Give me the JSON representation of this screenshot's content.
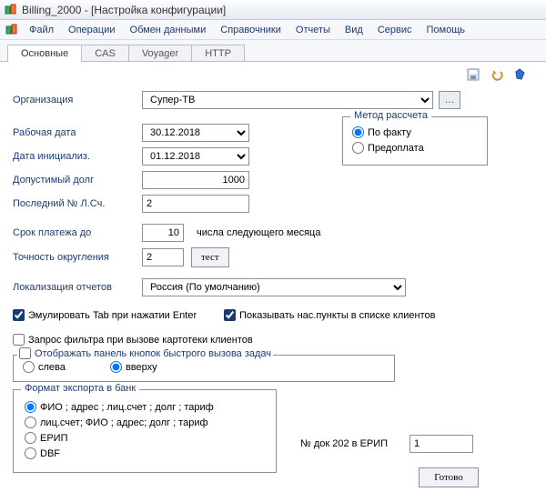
{
  "window": {
    "title": "Billing_2000 - [Настройка конфигурации]"
  },
  "menu": {
    "items": [
      "Файл",
      "Операции",
      "Обмен данными",
      "Справочники",
      "Отчеты",
      "Вид",
      "Сервис",
      "Помощь"
    ]
  },
  "tabs": [
    "Основные",
    "CAS",
    "Voyager",
    "HTTP"
  ],
  "toolbar": {
    "save": "save",
    "undo": "undo",
    "help": "help"
  },
  "labels": {
    "organization": "Организация",
    "working_date": "Рабочая дата",
    "init_date": "Дата инициализ.",
    "debt_limit": "Допустимый долг",
    "last_account_no": "Последний № Л.Сч.",
    "payment_due": "Срок платежа до",
    "payment_due_suffix": "числа следующего месяца",
    "rounding_precision": "Точность округления",
    "test_btn": "тест",
    "report_locale": "Локализация отчетов",
    "tab_emulate": "Эмулировать Tab при нажатии Enter",
    "show_localities": "Показывать нас.пункты в списке клиентов",
    "filter_prompt": "Запрос фильтра при вызове картотеки клиентов",
    "quick_panel": "Отображать панель кнопок быстрого вызова задач",
    "left": "слева",
    "top": "вверху",
    "export_format": "Формат экспорта в банк",
    "export_opt1": "ФИО ; адрес ; лиц.счет ; долг ; тариф",
    "export_opt2": "лиц.счет; ФИО ; адрес; долг ; тариф",
    "export_opt3": "ЕРИП",
    "export_opt4": "DBF",
    "erip_doc": "№ док 202 в ЕРИП",
    "done": "Готово",
    "method_title": "Метод рассчета",
    "method_fact": "По факту",
    "method_prepay": "Предоплата"
  },
  "values": {
    "organization": "Супер-ТВ",
    "working_date": "30.12.2018",
    "init_date": "01.12.2018",
    "debt_limit": "1000",
    "last_account_no": "2",
    "payment_due": "10",
    "rounding_precision": "2",
    "report_locale": "Россия (По умолчанию)",
    "tab_emulate": true,
    "show_localities": true,
    "filter_prompt": false,
    "quick_panel": false,
    "panel_pos": "top",
    "export_format": "opt1",
    "method": "fact",
    "erip_doc": "1"
  }
}
